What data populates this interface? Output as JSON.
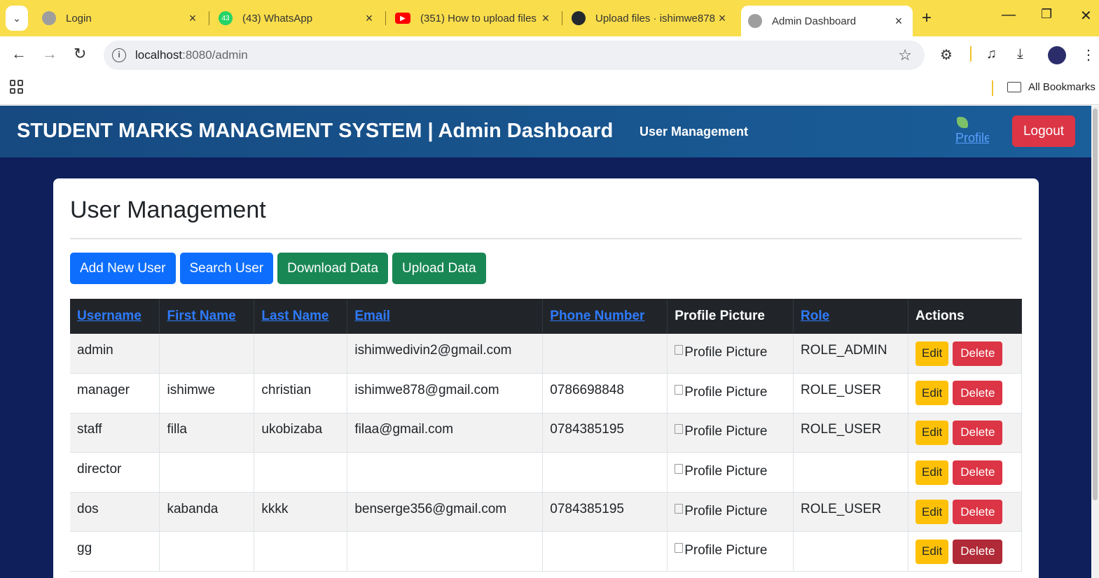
{
  "browser": {
    "tabs": [
      {
        "title": "Login",
        "favicon": "globe-icon"
      },
      {
        "title": "(43) WhatsApp",
        "favicon": "whatsapp-icon",
        "badge": "43"
      },
      {
        "title": "(351) How to upload files",
        "favicon": "youtube-icon"
      },
      {
        "title": "Upload files · ishimwe878",
        "favicon": "github-icon"
      },
      {
        "title": "Admin Dashboard",
        "favicon": "globe-icon",
        "active": true
      }
    ],
    "url_host": "localhost",
    "url_path": ":8080/admin",
    "bookmarks_label": "All Bookmarks"
  },
  "header": {
    "brand": "STUDENT MARKS MANAGMENT SYSTEM | Admin Dashboard",
    "nav_link": "User Management",
    "profile_alt": "Profile",
    "logout": "Logout"
  },
  "main": {
    "title": "User Management",
    "buttons": {
      "add": "Add New User",
      "search": "Search User",
      "download": "Download Data",
      "upload": "Upload Data"
    },
    "table": {
      "headers": {
        "username": "Username",
        "first_name": "First Name",
        "last_name": "Last Name",
        "email": "Email",
        "phone": "Phone Number",
        "picture": "Profile Picture",
        "role": "Role",
        "actions": "Actions"
      },
      "rows": [
        {
          "username": "admin",
          "first_name": "",
          "last_name": "",
          "email": "ishimwedivin2@gmail.com",
          "phone": "",
          "picture": "Profile Picture",
          "role": "ROLE_ADMIN"
        },
        {
          "username": "manager",
          "first_name": "ishimwe",
          "last_name": "christian",
          "email": "ishimwe878@gmail.com",
          "phone": "0786698848",
          "picture": "Profile Picture",
          "role": "ROLE_USER"
        },
        {
          "username": "staff",
          "first_name": "filla",
          "last_name": "ukobizaba",
          "email": "filaa@gmail.com",
          "phone": "0784385195",
          "picture": "Profile Picture",
          "role": "ROLE_USER"
        },
        {
          "username": "director",
          "first_name": "",
          "last_name": "",
          "email": "",
          "phone": "",
          "picture": "Profile Picture",
          "role": ""
        },
        {
          "username": "dos",
          "first_name": "kabanda",
          "last_name": "kkkk",
          "email": "benserge356@gmail.com",
          "phone": "0784385195",
          "picture": "Profile Picture",
          "role": "ROLE_USER"
        },
        {
          "username": "gg",
          "first_name": "",
          "last_name": "",
          "email": "",
          "phone": "",
          "picture": "Profile Picture",
          "role": ""
        }
      ],
      "edit_label": "Edit",
      "delete_label": "Delete"
    }
  },
  "colors": {
    "tabstrip": "#f9dd4b",
    "page_bg": "#0e1f5b",
    "appbar": "#1a5e9a",
    "primary": "#0d6efd",
    "success": "#198754",
    "danger": "#dc3545",
    "warning": "#ffc107"
  }
}
